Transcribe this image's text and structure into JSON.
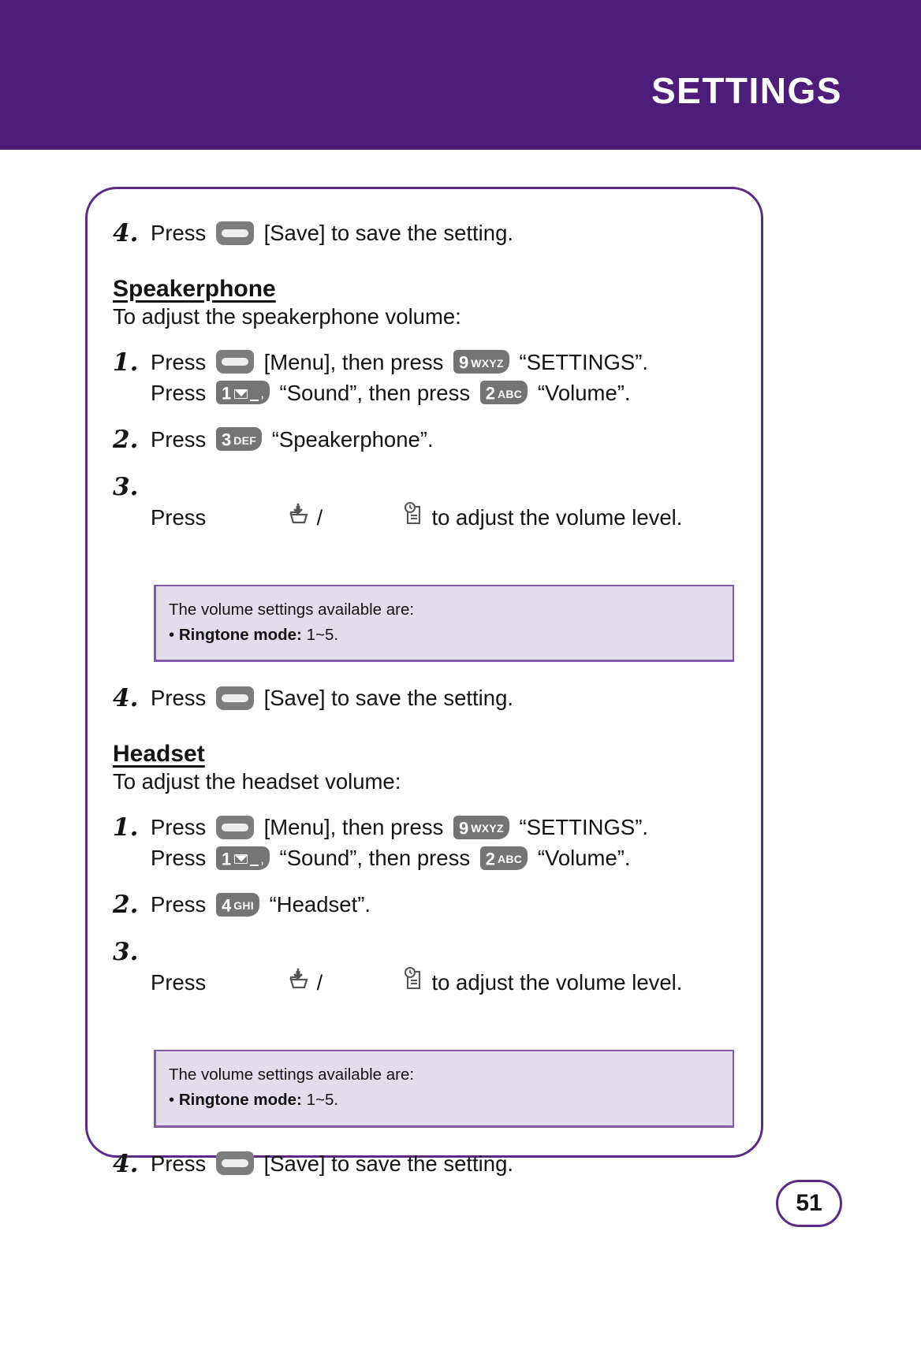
{
  "header": {
    "title": "SETTINGS",
    "bg_color": "#4e1c79"
  },
  "page_number": "51",
  "colors": {
    "header_purple": "#4e1c79",
    "border_purple": "#5b2a86",
    "note_fill": "#e2dced",
    "note_border": "#7e5ca8",
    "key_gray": "#747474"
  },
  "content": {
    "step4_top": {
      "number": "4.",
      "text_before": "Press ",
      "key": "soft-key",
      "text_after": " [Save] to save the setting."
    },
    "speakerphone": {
      "heading": "Speakerphone",
      "subtitle": "To adjust the speakerphone volume:",
      "steps": [
        {
          "number": "1.",
          "line1_a": "Press ",
          "line1_key": "soft-key",
          "line1_b": " [Menu], then press ",
          "line1_key2_digit": "9",
          "line1_key2_letters": "WXYZ",
          "line1_c": " “SETTINGS”.",
          "line2_a": "Press ",
          "line2_key_digit": "1",
          "line2_b": " “Sound”, then press ",
          "line2_key2_digit": "2",
          "line2_key2_letters": "ABC",
          "line2_c": " “Volume”."
        },
        {
          "number": "2.",
          "text_before": "Press ",
          "key_digit": "3",
          "key_letters": "DEF",
          "text_after": " “Speakerphone”."
        },
        {
          "number": "3.",
          "text_before": "Press ",
          "icon1": "volume-down-icon",
          "separator": "/",
          "icon2": "volume-up-icon",
          "text_after": " to adjust the volume level."
        }
      ],
      "note": {
        "line1": "The volume settings available are:",
        "bullet": "• ",
        "bullet_label": "Ringtone mode:",
        "bullet_value": " 1~5."
      },
      "step4": {
        "number": "4.",
        "text_before": "Press ",
        "key": "soft-key",
        "text_after": " [Save] to save the setting."
      }
    },
    "headset": {
      "heading": "Headset",
      "subtitle": "To adjust the headset volume:",
      "steps": [
        {
          "number": "1.",
          "line1_a": "Press ",
          "line1_key": "soft-key",
          "line1_b": " [Menu], then press ",
          "line1_key2_digit": "9",
          "line1_key2_letters": "WXYZ",
          "line1_c": " “SETTINGS”.",
          "line2_a": "Press ",
          "line2_key_digit": "1",
          "line2_b": " “Sound”, then press ",
          "line2_key2_digit": "2",
          "line2_key2_letters": "ABC",
          "line2_c": " “Volume”."
        },
        {
          "number": "2.",
          "text_before": "Press ",
          "key_digit": "4",
          "key_letters": "GHI",
          "text_after": " “Headset”."
        },
        {
          "number": "3.",
          "text_before": "Press ",
          "icon1": "volume-down-icon",
          "separator": "/",
          "icon2": "volume-up-icon",
          "text_after": " to adjust the volume level."
        }
      ],
      "note": {
        "line1": "The volume settings available are:",
        "bullet": "• ",
        "bullet_label": "Ringtone mode:",
        "bullet_value": " 1~5."
      },
      "step4": {
        "number": "4.",
        "text_before": "Press ",
        "key": "soft-key",
        "text_after": " [Save] to save the setting."
      }
    }
  }
}
